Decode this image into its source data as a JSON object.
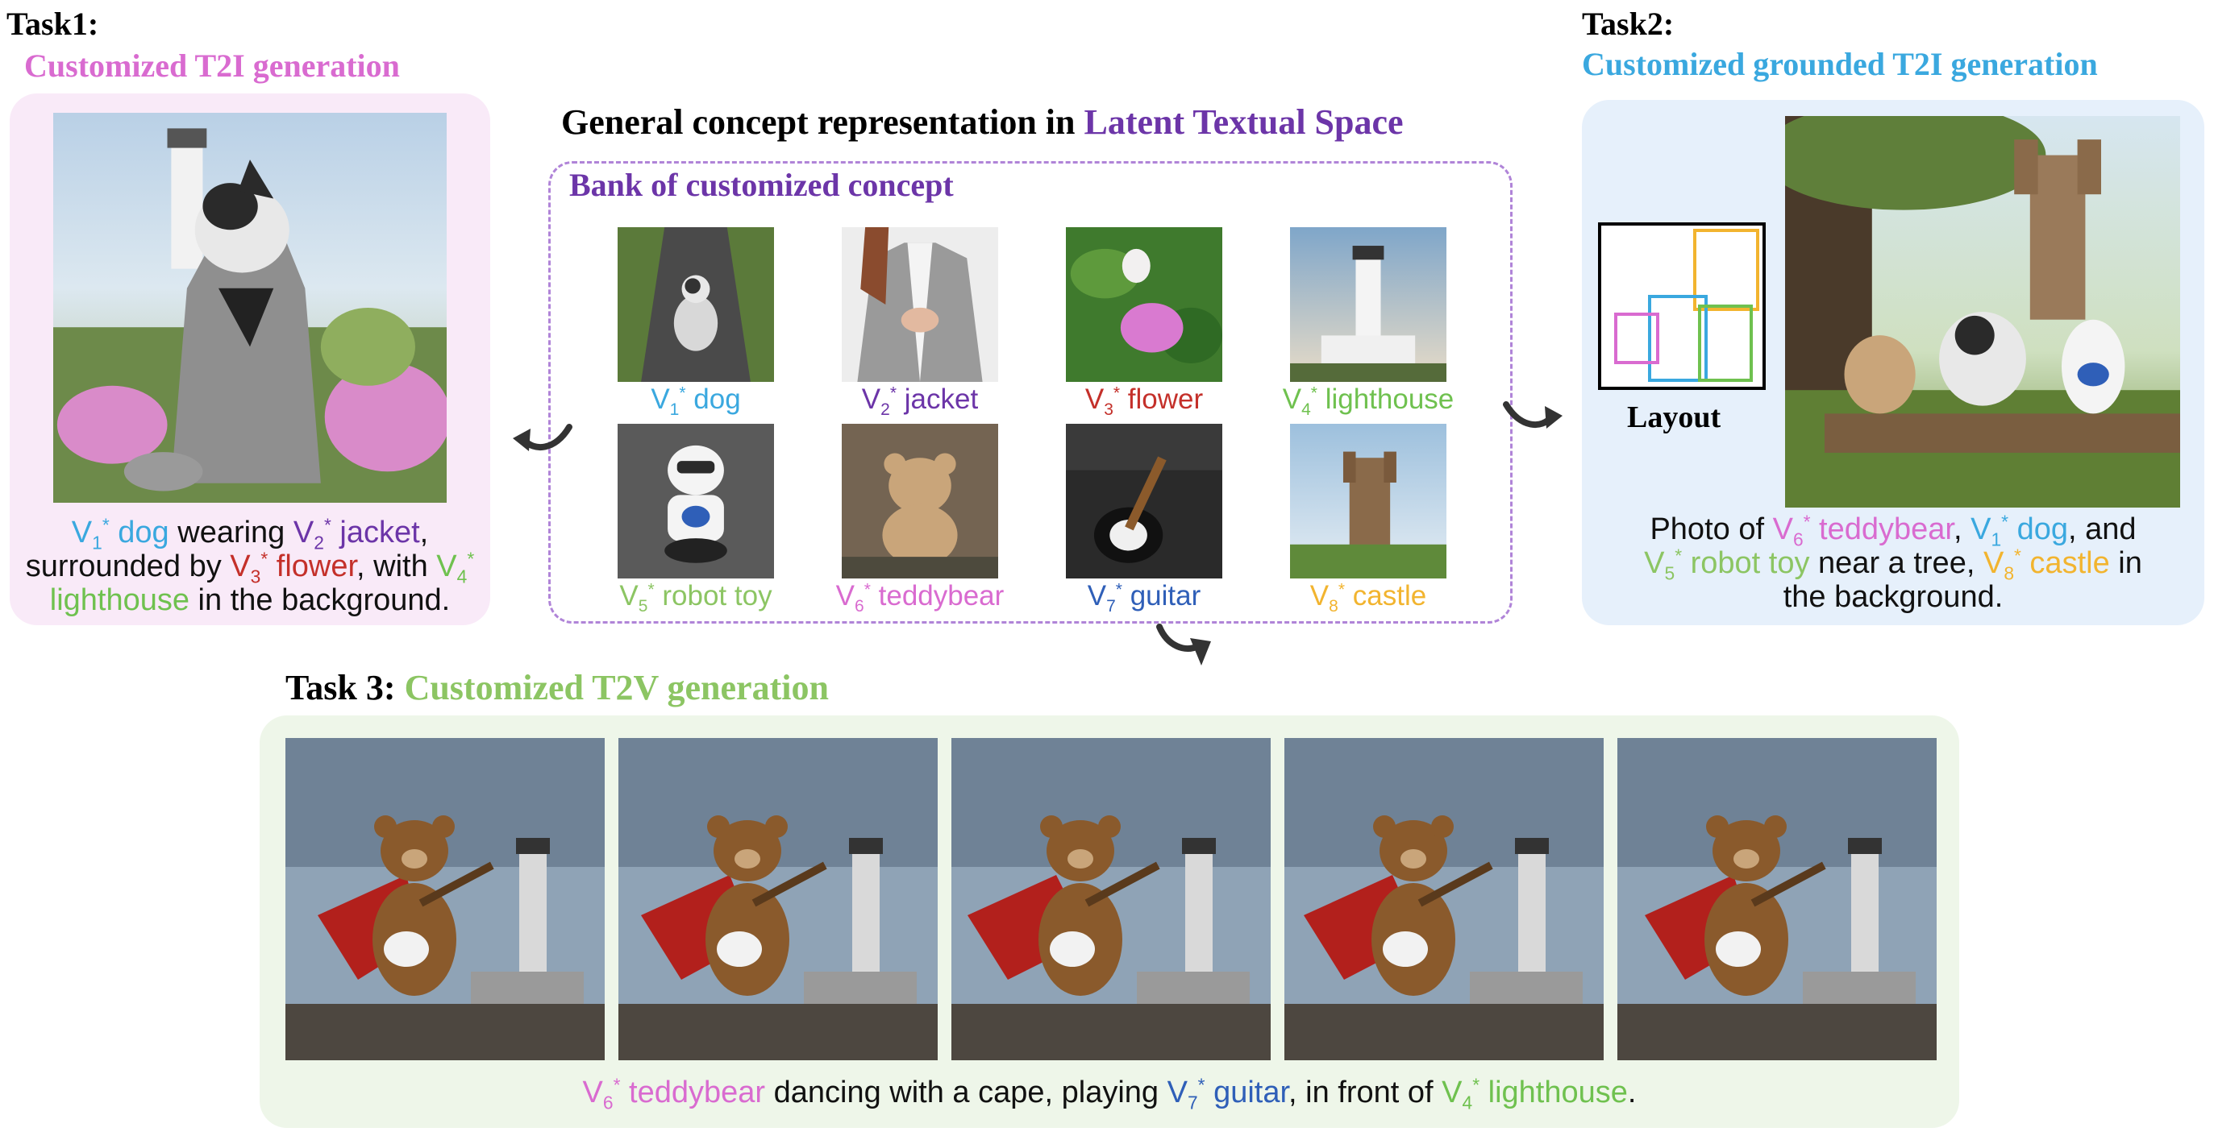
{
  "colors": {
    "pink": "#d96bd0",
    "sky": "#3aa8df",
    "purple": "#6c35a8",
    "red": "#c4302a",
    "green": "#6fc14f",
    "lgreen": "#8cc563",
    "orange": "#f2b42f",
    "blue": "#2f5fb8",
    "panel_pink": "#f9eaf8",
    "panel_blue": "#e6f0fb",
    "panel_green": "#eef6e9",
    "bank_border": "#b084d8"
  },
  "task1": {
    "label": "Task1:",
    "title": "Customized T2I generation",
    "caption": {
      "l1_a": "V",
      "l1_a_sub": "1",
      "l1_a_sup": "*",
      "l1_b": " dog",
      "l1_c": " wearing ",
      "l1_d": "V",
      "l1_d_sub": "2",
      "l1_d_sup": "*",
      "l1_e": " jacket",
      "l1_f": ",",
      "l2_a": "surrounded by ",
      "l2_b": "V",
      "l2_b_sub": "3",
      "l2_b_sup": "*",
      "l2_c": " flower",
      "l2_d": ", with ",
      "l2_e": "V",
      "l2_e_sub": "4",
      "l2_e_sup": "*",
      "l3_a": "lighthouse",
      "l3_b": " in the background."
    }
  },
  "center": {
    "heading_a": "General concept representation in ",
    "heading_b": "Latent Textual Space",
    "bank_title": "Bank of customized concept",
    "concepts": [
      {
        "v": "V",
        "sub": "1",
        "sup": "*",
        "name": " dog",
        "icon": "dog-photo"
      },
      {
        "v": "V",
        "sub": "2",
        "sup": "*",
        "name": " jacket",
        "icon": "jacket-photo"
      },
      {
        "v": "V",
        "sub": "3",
        "sup": "*",
        "name": " flower",
        "icon": "flower-photo"
      },
      {
        "v": "V",
        "sub": "4",
        "sup": "*",
        "name": " lighthouse",
        "icon": "lighthouse-photo"
      },
      {
        "v": "V",
        "sub": "5",
        "sup": "*",
        "name": " robot toy",
        "icon": "robot-photo"
      },
      {
        "v": "V",
        "sub": "6",
        "sup": "*",
        "name": " teddybear",
        "icon": "teddybear-photo"
      },
      {
        "v": "V",
        "sub": "7",
        "sup": "*",
        "name": " guitar",
        "icon": "guitar-photo"
      },
      {
        "v": "V",
        "sub": "8",
        "sup": "*",
        "name": " castle",
        "icon": "castle-photo"
      }
    ]
  },
  "task2": {
    "label": "Task2:",
    "title": "Customized grounded T2I generation",
    "layout_label": "Layout",
    "caption": {
      "l1_a": "Photo of ",
      "l1_b": "V",
      "l1_b_sub": "6",
      "l1_b_sup": "*",
      "l1_c": " teddybear",
      "l1_d": ", ",
      "l1_e": "V",
      "l1_e_sub": "1",
      "l1_e_sup": "*",
      "l1_f": " dog",
      "l1_g": ", and",
      "l2_a": "V",
      "l2_a_sub": "5",
      "l2_a_sup": "*",
      "l2_b": " robot toy",
      "l2_c": " near a tree, ",
      "l2_d": "V",
      "l2_d_sub": "8",
      "l2_d_sup": "*",
      "l2_e": " castle",
      "l2_f": " in",
      "l3_a": "the background."
    }
  },
  "task3": {
    "label": "Task 3: ",
    "title": "Customized T2V generation",
    "caption": {
      "a": "V",
      "a_sub": "6",
      "a_sup": "*",
      "b": " teddybear",
      "c": " dancing with a cape, playing ",
      "d": "V",
      "d_sub": "7",
      "d_sup": "*",
      "e": " guitar",
      "f": ", in front of ",
      "g": "V",
      "g_sub": "4",
      "g_sup": "*",
      "h": " lighthouse",
      "i": "."
    }
  }
}
